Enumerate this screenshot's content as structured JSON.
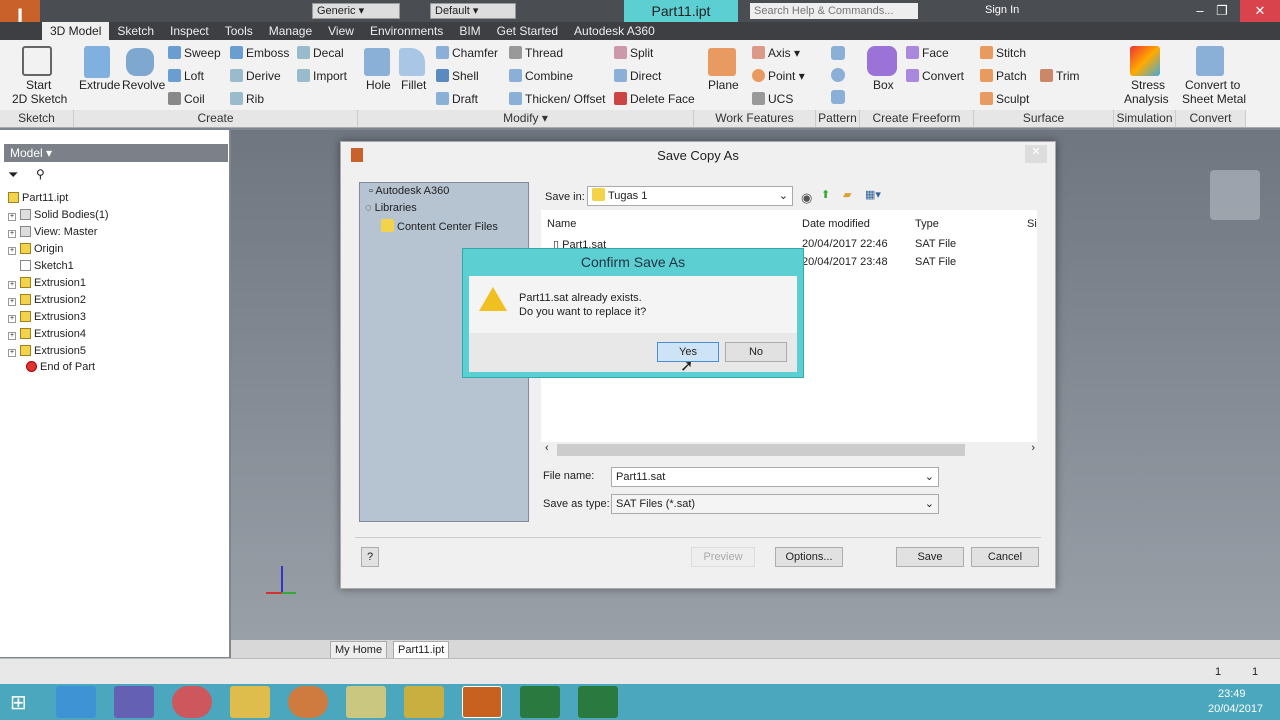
{
  "titlebar": {
    "workspace": "Generic",
    "appearance": "Default",
    "document": "Part11.ipt",
    "search_placeholder": "Search Help & Commands...",
    "sign_in": "Sign In",
    "minimize": "–",
    "restore": "❐",
    "close": "✕"
  },
  "tabs": [
    "3D Model",
    "Sketch",
    "Inspect",
    "Tools",
    "Manage",
    "View",
    "Environments",
    "BIM",
    "Get Started",
    "Autodesk A360"
  ],
  "ribbon": {
    "sketch": {
      "start": "Start",
      "start2": "2D Sketch"
    },
    "create": {
      "extrude": "Extrude",
      "revolve": "Revolve",
      "sweep": "Sweep",
      "loft": "Loft",
      "coil": "Coil",
      "emboss": "Emboss",
      "derive": "Derive",
      "rib": "Rib",
      "decal": "Decal",
      "import": "Import"
    },
    "modify": {
      "hole": "Hole",
      "fillet": "Fillet",
      "chamfer": "Chamfer",
      "shell": "Shell",
      "draft": "Draft",
      "thread": "Thread",
      "combine": "Combine",
      "thicken": "Thicken/ Offset",
      "split": "Split",
      "direct": "Direct",
      "delete_face": "Delete Face"
    },
    "work": {
      "plane": "Plane",
      "axis": "Axis",
      "point": "Point",
      "ucs": "UCS"
    },
    "freeform": {
      "box": "Box",
      "face": "Face",
      "convert": "Convert"
    },
    "surface": {
      "stitch": "Stitch",
      "patch": "Patch",
      "sculpt": "Sculpt",
      "trim": "Trim"
    },
    "simulation": {
      "stress1": "Stress",
      "stress2": "Analysis"
    },
    "convert": {
      "c1": "Convert to",
      "c2": "Sheet Metal"
    },
    "panels": [
      "Sketch",
      "Create",
      "Modify ▾",
      "Work Features",
      "Pattern",
      "Create Freeform",
      "Surface",
      "Simulation",
      "Convert"
    ]
  },
  "browser": {
    "title": "Model ▾",
    "items": [
      "Part11.ipt",
      "Solid Bodies(1)",
      "View: Master",
      "Origin",
      "Sketch1",
      "Extrusion1",
      "Extrusion2",
      "Extrusion3",
      "Extrusion4",
      "Extrusion5",
      "End of Part"
    ]
  },
  "doc_tabs": {
    "home": "My Home",
    "part": "Part11.ipt"
  },
  "status": {
    "a": "1",
    "b": "1"
  },
  "clock": {
    "time": "23:49",
    "date": "20/04/2017"
  },
  "save_dialog": {
    "title": "Save Copy As",
    "locations": [
      "Autodesk A360",
      "Libraries",
      "Content Center Files"
    ],
    "save_in_label": "Save in:",
    "save_in": "Tugas 1",
    "columns": [
      "Name",
      "Date modified",
      "Type",
      "Si"
    ],
    "files": [
      {
        "name": "Part1.sat",
        "date": "20/04/2017 22:46",
        "type": "SAT File"
      },
      {
        "name": "",
        "date": "20/04/2017 23:48",
        "type": "SAT File"
      }
    ],
    "file_name_label": "File name:",
    "file_name": "Part11.sat",
    "type_label": "Save as type:",
    "type": "SAT Files (*.sat)",
    "preview": "Preview",
    "options": "Options...",
    "save": "Save",
    "cancel": "Cancel",
    "help": "?"
  },
  "confirm": {
    "title": "Confirm Save As",
    "line1": "Part11.sat already exists.",
    "line2": "Do you want to replace it?",
    "yes": "Yes",
    "no": "No"
  }
}
